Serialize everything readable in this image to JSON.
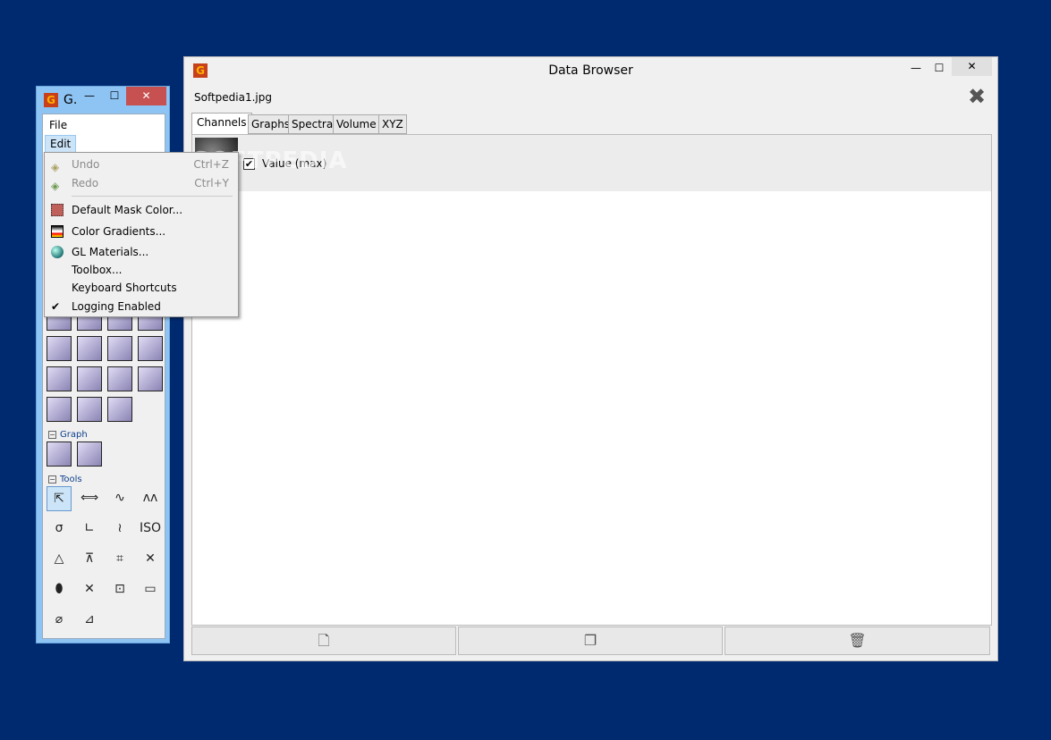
{
  "toolbox": {
    "title": "G.",
    "menubar": [
      "File",
      "Edit"
    ],
    "sections": {
      "graph": "Graph",
      "tools": "Tools"
    },
    "data_icons": [
      "measure-icon",
      "mask-icon",
      "crop-icon",
      "stack-icon",
      "gradient-icon",
      "grains-icon",
      "lines-icon",
      "rows-icon",
      "particles-icon",
      "drop-icon",
      "mark-icon",
      "spectrum-icon",
      "sphere-icon",
      "curve-icon",
      "mask-remove-icon"
    ],
    "graph_icons": [
      "graph-measure-icon",
      "graph-fit-icon"
    ],
    "tool_icons": [
      "pointer-ruler-icon",
      "distance-icon",
      "profile-icon",
      "spectro-icon",
      "statistics-icon",
      "decay-icon",
      "path-icon",
      "iso-roughness-icon",
      "level-icon",
      "line-correct-icon",
      "crop-tool-icon",
      "mask-editor-icon",
      "grain-measure-icon",
      "grain-remove-icon",
      "selection-icon",
      "color-range-icon",
      "filter-icon",
      "selection-manager-icon"
    ],
    "tool_glyphs": [
      "⇱",
      "⟺",
      "∿",
      "ʌʌ",
      "σ",
      "∟",
      "≀",
      "ISO",
      "△",
      "⊼",
      "⌗",
      "✕",
      "⬮",
      "✕",
      "⊡",
      "▭",
      "⌀",
      "⊿"
    ]
  },
  "edit_menu": {
    "items": [
      {
        "label": "Undo",
        "shortcut": "Ctrl+Z",
        "disabled": true,
        "icon": "undo-icon"
      },
      {
        "label": "Redo",
        "shortcut": "Ctrl+Y",
        "disabled": true,
        "icon": "redo-icon"
      },
      {
        "label": "Default Mask Color...",
        "icon": "mask-color-icon"
      },
      {
        "label": "Color Gradients...",
        "icon": "gradients-icon"
      },
      {
        "label": "GL Materials...",
        "icon": "gl-materials-icon"
      },
      {
        "label": "Toolbox..."
      },
      {
        "label": "Keyboard Shortcuts"
      },
      {
        "label": "Logging Enabled",
        "checked": true
      }
    ]
  },
  "data_browser": {
    "title": "Data Browser",
    "filename": "Softpedia1.jpg",
    "tabs": [
      "Channels",
      "Graphs",
      "Spectra",
      "Volume",
      "XYZ"
    ],
    "active_tab": "Channels",
    "channels": [
      {
        "title": "Value (max)",
        "visible": true
      }
    ],
    "buttons": [
      "new-icon",
      "duplicate-icon",
      "delete-icon"
    ]
  },
  "watermark": "SOFTPEDIA"
}
